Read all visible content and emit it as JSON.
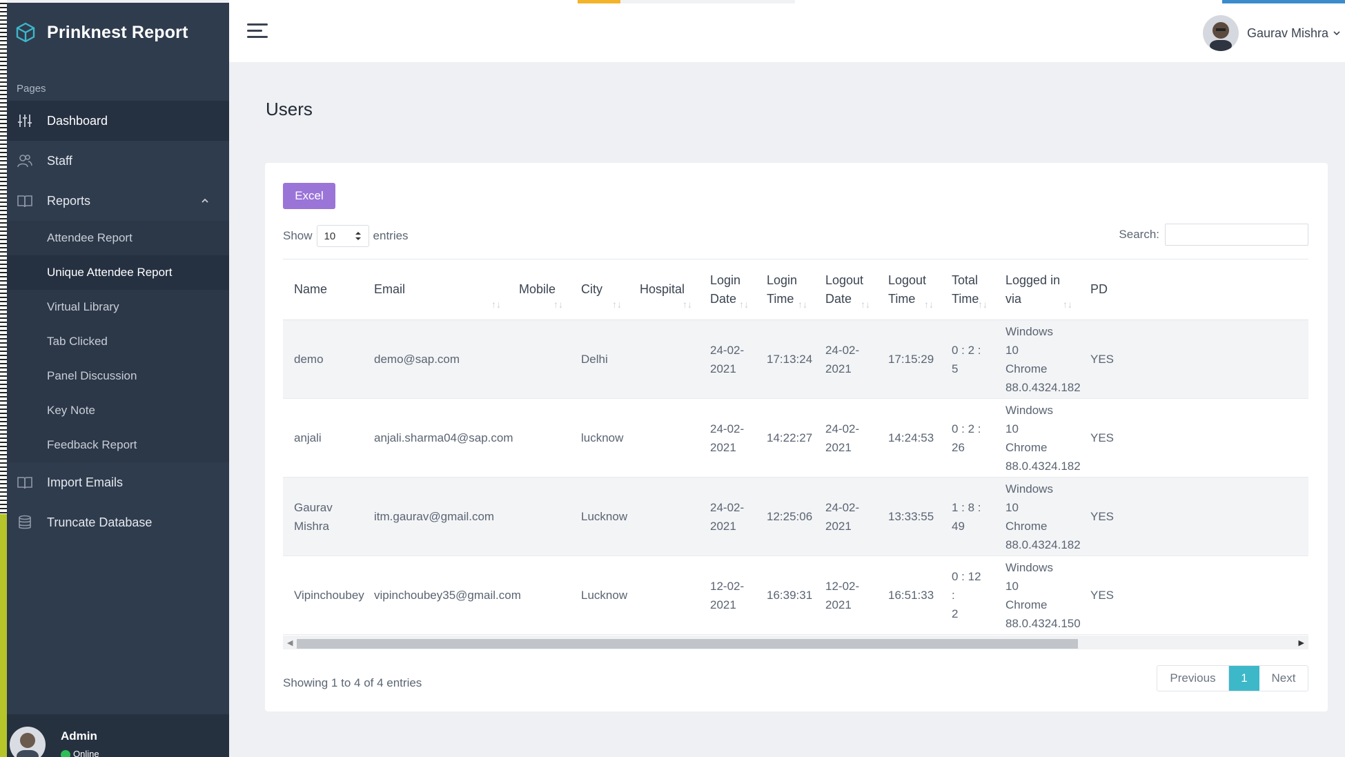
{
  "brand": {
    "title": "Prinknest Report"
  },
  "sidebar": {
    "section_label": "Pages",
    "items": [
      {
        "label": "Dashboard",
        "icon": "sliders-icon"
      },
      {
        "label": "Staff",
        "icon": "users-icon"
      },
      {
        "label": "Reports",
        "icon": "book-icon"
      }
    ],
    "reports_submenu": [
      "Attendee Report",
      "Unique Attendee Report",
      "Virtual Library",
      "Tab Clicked",
      "Panel Discussion",
      "Key Note",
      "Feedback Report"
    ],
    "bottom_items": [
      {
        "label": "Import Emails",
        "icon": "book-icon"
      },
      {
        "label": "Truncate Database",
        "icon": "database-icon"
      }
    ],
    "user": {
      "name": "Admin",
      "status": "Online"
    }
  },
  "topbar": {
    "user_name": "Gaurav Mishra"
  },
  "page": {
    "title": "Users"
  },
  "toolbar": {
    "excel_label": "Excel"
  },
  "length": {
    "show_label": "Show",
    "value": "10",
    "entries_label": "entries"
  },
  "search": {
    "label": "Search:",
    "value": ""
  },
  "table": {
    "headers": [
      [
        "Name"
      ],
      [
        "Email"
      ],
      [
        "Mobile"
      ],
      [
        "City"
      ],
      [
        "Hospital"
      ],
      [
        "Login",
        "Date"
      ],
      [
        "Login",
        "Time"
      ],
      [
        "Logout",
        "Date"
      ],
      [
        "Logout",
        "Time"
      ],
      [
        "Total",
        "Time"
      ],
      [
        "Logged in",
        "via"
      ],
      [
        "PD"
      ]
    ],
    "rows": [
      {
        "name": [
          "demo"
        ],
        "email": "demo@sap.com",
        "mobile": "",
        "city": "Delhi",
        "hospital": "",
        "login_date": [
          "24-02-",
          "2021"
        ],
        "login_time": "17:13:24",
        "logout_date": [
          "24-02-",
          "2021"
        ],
        "logout_time": "17:15:29",
        "total_time": [
          "0 : 2 : 5"
        ],
        "via": [
          "Windows 10",
          "Chrome",
          "88.0.4324.182"
        ],
        "pd": "YES"
      },
      {
        "name": [
          "anjali"
        ],
        "email": "anjali.sharma04@sap.com",
        "mobile": "",
        "city": "lucknow",
        "hospital": "",
        "login_date": [
          "24-02-",
          "2021"
        ],
        "login_time": "14:22:27",
        "logout_date": [
          "24-02-",
          "2021"
        ],
        "logout_time": "14:24:53",
        "total_time": [
          "0 : 2 :",
          "26"
        ],
        "via": [
          "Windows 10",
          "Chrome",
          "88.0.4324.182"
        ],
        "pd": "YES"
      },
      {
        "name": [
          "Gaurav",
          "Mishra"
        ],
        "email": "itm.gaurav@gmail.com",
        "mobile": "",
        "city": "Lucknow",
        "hospital": "",
        "login_date": [
          "24-02-",
          "2021"
        ],
        "login_time": "12:25:06",
        "logout_date": [
          "24-02-",
          "2021"
        ],
        "logout_time": "13:33:55",
        "total_time": [
          "1 : 8 :",
          "49"
        ],
        "via": [
          "Windows 10",
          "Chrome",
          "88.0.4324.182"
        ],
        "pd": "YES"
      },
      {
        "name": [
          "Vipinchoubey"
        ],
        "email": "vipinchoubey35@gmail.com",
        "mobile": "",
        "city": "Lucknow",
        "hospital": "",
        "login_date": [
          "12-02-",
          "2021"
        ],
        "login_time": "16:39:31",
        "logout_date": [
          "12-02-",
          "2021"
        ],
        "logout_time": "16:51:33",
        "total_time": [
          "0 : 12 :",
          "2"
        ],
        "via": [
          "Windows 10",
          "Chrome",
          "88.0.4324.150"
        ],
        "pd": "YES"
      }
    ]
  },
  "footer": {
    "info": "Showing 1 to 4 of 4 entries"
  },
  "pagination": {
    "previous": "Previous",
    "current": "1",
    "next": "Next"
  },
  "colors": {
    "sidebar": "#2f3c4e",
    "excel_button": "#9b74d8",
    "page_active": "#3cb8c9",
    "loader": "#f3b42a"
  }
}
